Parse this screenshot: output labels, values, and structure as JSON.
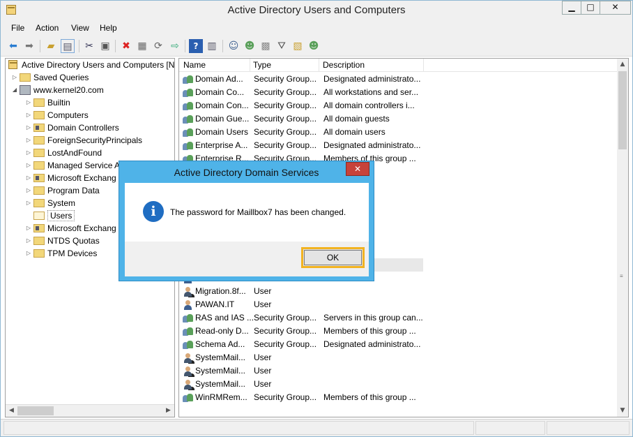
{
  "window": {
    "title": "Active Directory Users and Computers",
    "controls": {
      "minimize": "▁",
      "maximize": "□",
      "close": "✕"
    }
  },
  "menu": [
    "File",
    "Action",
    "View",
    "Help"
  ],
  "toolbar": {
    "icons": [
      "back-icon",
      "forward-icon",
      "up-folder-icon",
      "show-console-tree-icon",
      "cut-icon",
      "copy-icon",
      "delete-icon",
      "properties-icon",
      "refresh-icon",
      "export-list-icon",
      "help-icon",
      "view-icon",
      "new-user-icon",
      "new-group-icon",
      "new-ou-icon",
      "filter-icon",
      "find-icon",
      "add-to-group-icon"
    ]
  },
  "tree": {
    "root": "Active Directory Users and Computers [N",
    "items": [
      {
        "label": "Saved Queries",
        "arrow": "▷",
        "icon": "folder-icon"
      },
      {
        "label": "www.kernel20.com",
        "arrow": "◢",
        "icon": "domain-icon"
      },
      {
        "label": "Builtin",
        "arrow": "▷",
        "icon": "folder-icon"
      },
      {
        "label": "Computers",
        "arrow": "▷",
        "icon": "folder-icon"
      },
      {
        "label": "Domain Controllers",
        "arrow": "▷",
        "icon": "ou-icon"
      },
      {
        "label": "ForeignSecurityPrincipals",
        "arrow": "▷",
        "icon": "folder-icon"
      },
      {
        "label": "LostAndFound",
        "arrow": "▷",
        "icon": "folder-icon"
      },
      {
        "label": "Managed Service A",
        "arrow": "▷",
        "icon": "folder-icon"
      },
      {
        "label": "Microsoft Exchang",
        "arrow": "▷",
        "icon": "ou-icon"
      },
      {
        "label": "Program Data",
        "arrow": "▷",
        "icon": "folder-icon"
      },
      {
        "label": "System",
        "arrow": "▷",
        "icon": "folder-icon"
      },
      {
        "label": "Users",
        "arrow": "",
        "icon": "open-folder-icon"
      },
      {
        "label": "Microsoft Exchang",
        "arrow": "▷",
        "icon": "ou-icon"
      },
      {
        "label": "NTDS Quotas",
        "arrow": "▷",
        "icon": "folder-icon"
      },
      {
        "label": "TPM Devices",
        "arrow": "▷",
        "icon": "folder-icon"
      }
    ]
  },
  "list": {
    "columns": [
      "Name",
      "Type",
      "Description"
    ],
    "rows": [
      {
        "name": "Domain Ad...",
        "type": "Security Group...",
        "desc": "Designated administrato...",
        "icon": "group-icon"
      },
      {
        "name": "Domain Co...",
        "type": "Security Group...",
        "desc": "All workstations and ser...",
        "icon": "group-icon"
      },
      {
        "name": "Domain Con...",
        "type": "Security Group...",
        "desc": "All domain controllers i...",
        "icon": "group-icon"
      },
      {
        "name": "Domain Gue...",
        "type": "Security Group...",
        "desc": "All domain guests",
        "icon": "group-icon"
      },
      {
        "name": "Domain Users",
        "type": "Security Group...",
        "desc": "All domain users",
        "icon": "group-icon"
      },
      {
        "name": "Enterprise A...",
        "type": "Security Group...",
        "desc": "Designated administrato...",
        "icon": "group-icon"
      },
      {
        "name": "Enterprise R...",
        "type": "Security Group...",
        "desc": "Members of this group ...",
        "icon": "group-icon"
      },
      {
        "name": "",
        "type": "",
        "desc": "",
        "icon": "group-icon"
      },
      {
        "name": "",
        "type": "",
        "desc": "",
        "icon": "group-icon"
      },
      {
        "name": "",
        "type": "",
        "desc": "his group c...",
        "icon": "group-icon"
      },
      {
        "name": "",
        "type": "",
        "desc": "nt for gue...",
        "icon": "user-icon"
      },
      {
        "name": "",
        "type": "",
        "desc": "",
        "icon": "user-icon"
      },
      {
        "name": "",
        "type": "",
        "desc": "on Center ...",
        "icon": "user-icon"
      },
      {
        "name": "",
        "type": "",
        "desc": "",
        "icon": "user-icon"
      },
      {
        "name": "",
        "type": "",
        "desc": "",
        "icon": "user-icon"
      },
      {
        "name": "",
        "type": "",
        "desc": "",
        "icon": "user-icon"
      },
      {
        "name": "Migration.8f...",
        "type": "User",
        "desc": "",
        "icon": "disabled-user-icon"
      },
      {
        "name": "PAWAN.IT",
        "type": "User",
        "desc": "",
        "icon": "user-icon"
      },
      {
        "name": "RAS and IAS ...",
        "type": "Security Group...",
        "desc": "Servers in this group can...",
        "icon": "group-icon"
      },
      {
        "name": "Read-only D...",
        "type": "Security Group...",
        "desc": "Members of this group ...",
        "icon": "group-icon"
      },
      {
        "name": "Schema Ad...",
        "type": "Security Group...",
        "desc": "Designated administrato...",
        "icon": "group-icon"
      },
      {
        "name": "SystemMail...",
        "type": "User",
        "desc": "",
        "icon": "disabled-user-icon"
      },
      {
        "name": "SystemMail...",
        "type": "User",
        "desc": "",
        "icon": "disabled-user-icon"
      },
      {
        "name": "SystemMail...",
        "type": "User",
        "desc": "",
        "icon": "disabled-user-icon"
      },
      {
        "name": "WinRMRem...",
        "type": "Security Group...",
        "desc": "Members of this group ...",
        "icon": "group-icon"
      }
    ]
  },
  "dialog": {
    "title": "Active Directory Domain Services",
    "close": "✕",
    "icon": "information-icon",
    "icon_glyph": "i",
    "message": "The password for Maillbox7 has been changed.",
    "ok_label": "OK",
    "accent": "#4fb3e8",
    "focus_color": "#f2b321"
  },
  "scroll": {
    "up": "▲",
    "down": "▼",
    "left": "◀",
    "right": "▶"
  }
}
